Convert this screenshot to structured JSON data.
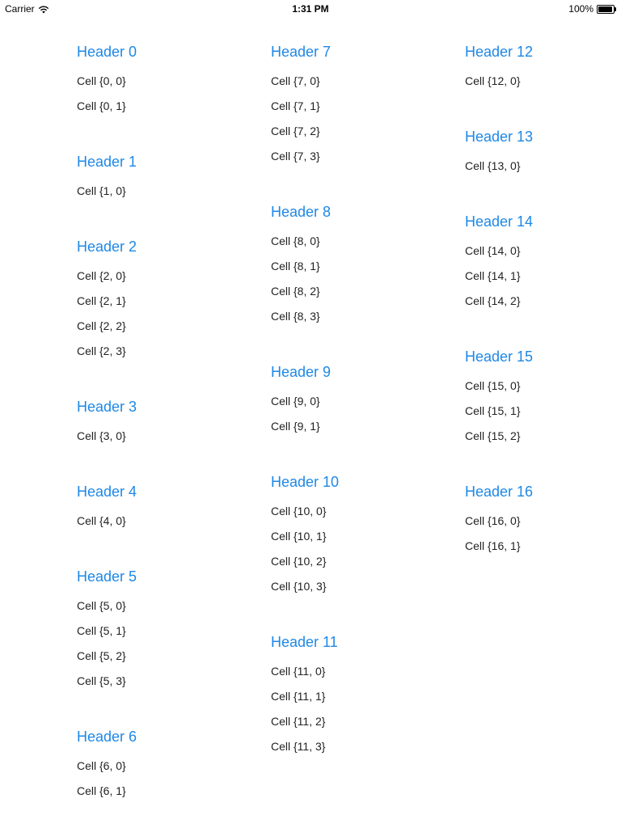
{
  "status_bar": {
    "carrier": "Carrier",
    "time": "1:31 PM",
    "battery": "100%",
    "wifi_icon": "wifi-icon",
    "battery_icon": "battery-icon"
  },
  "accent_color": "#1e88e5",
  "columns": [
    {
      "sections": [
        {
          "header": "Header 0",
          "cells": [
            "Cell {0, 0}",
            "Cell {0, 1}"
          ]
        },
        {
          "header": "Header 1",
          "cells": [
            "Cell {1, 0}"
          ]
        },
        {
          "header": "Header 2",
          "cells": [
            "Cell {2, 0}",
            "Cell {2, 1}",
            "Cell {2, 2}",
            "Cell {2, 3}"
          ]
        },
        {
          "header": "Header 3",
          "cells": [
            "Cell {3, 0}"
          ]
        },
        {
          "header": "Header 4",
          "cells": [
            "Cell {4, 0}"
          ]
        },
        {
          "header": "Header 5",
          "cells": [
            "Cell {5, 0}",
            "Cell {5, 1}",
            "Cell {5, 2}",
            "Cell {5, 3}"
          ]
        },
        {
          "header": "Header 6",
          "cells": [
            "Cell {6, 0}",
            "Cell {6, 1}"
          ]
        }
      ]
    },
    {
      "sections": [
        {
          "header": "Header 7",
          "cells": [
            "Cell {7, 0}",
            "Cell {7, 1}",
            "Cell {7, 2}",
            "Cell {7, 3}"
          ]
        },
        {
          "header": "Header 8",
          "cells": [
            "Cell {8, 0}",
            "Cell {8, 1}",
            "Cell {8, 2}",
            "Cell {8, 3}"
          ]
        },
        {
          "header": "Header 9",
          "cells": [
            "Cell {9, 0}",
            "Cell {9, 1}"
          ]
        },
        {
          "header": "Header 10",
          "cells": [
            "Cell {10, 0}",
            "Cell {10, 1}",
            "Cell {10, 2}",
            "Cell {10, 3}"
          ]
        },
        {
          "header": "Header 11",
          "cells": [
            "Cell {11, 0}",
            "Cell {11, 1}",
            "Cell {11, 2}",
            "Cell {11, 3}"
          ]
        }
      ]
    },
    {
      "sections": [
        {
          "header": "Header 12",
          "cells": [
            "Cell {12, 0}"
          ]
        },
        {
          "header": "Header 13",
          "cells": [
            "Cell {13, 0}"
          ]
        },
        {
          "header": "Header 14",
          "cells": [
            "Cell {14, 0}",
            "Cell {14, 1}",
            "Cell {14, 2}"
          ]
        },
        {
          "header": "Header 15",
          "cells": [
            "Cell {15, 0}",
            "Cell {15, 1}",
            "Cell {15, 2}"
          ]
        },
        {
          "header": "Header 16",
          "cells": [
            "Cell {16, 0}",
            "Cell {16, 1}"
          ]
        }
      ]
    }
  ]
}
